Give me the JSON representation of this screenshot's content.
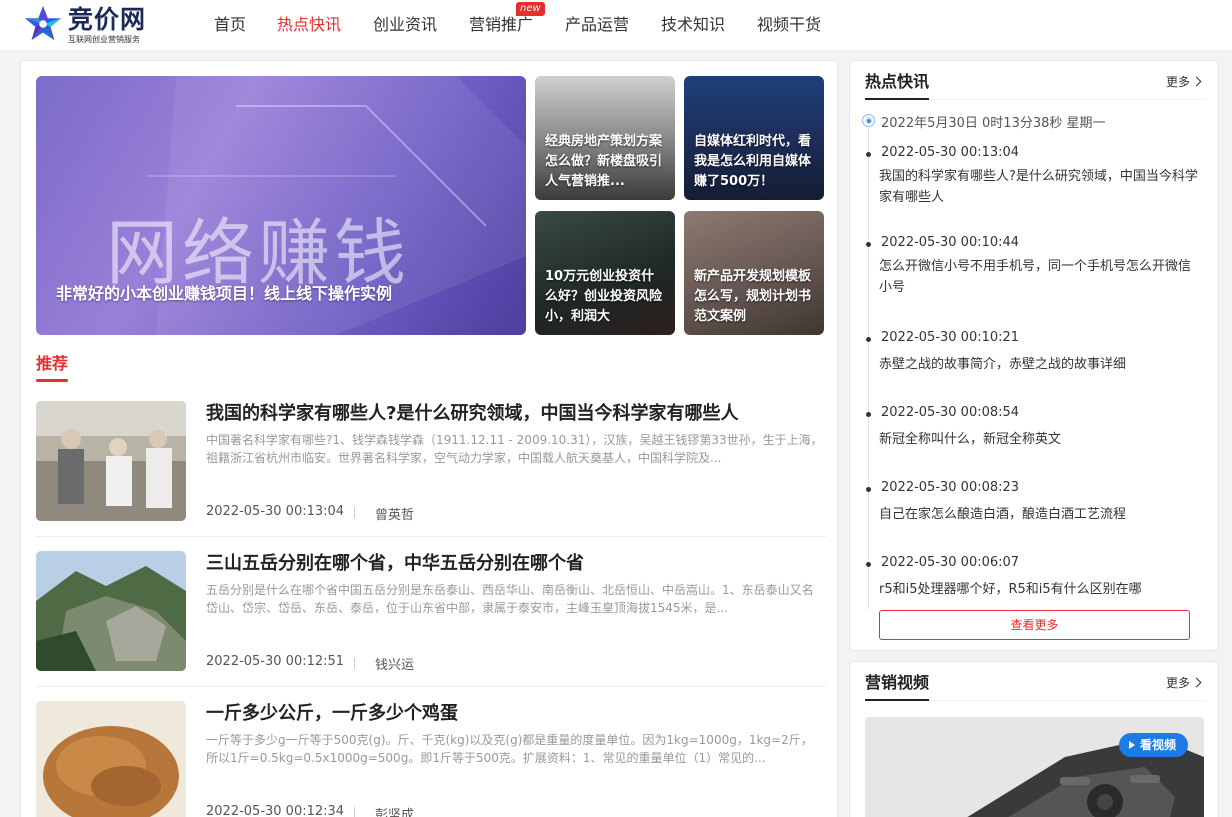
{
  "brand": {
    "name": "竞价网",
    "tagline": "互联网创业营销服务"
  },
  "nav": {
    "items": [
      {
        "label": "首页"
      },
      {
        "label": "热点快讯"
      },
      {
        "label": "创业资讯"
      },
      {
        "label": "营销推广"
      },
      {
        "label": "产品运营"
      },
      {
        "label": "技术知识"
      },
      {
        "label": "视频干货"
      }
    ],
    "active_index": 1,
    "new_badge": "new"
  },
  "hero": {
    "main": {
      "image_text": "网络赚钱",
      "caption": "非常好的小本创业赚钱项目！线上线下操作实例"
    },
    "thumbs": [
      {
        "caption": "经典房地产策划方案怎么做？新楼盘吸引人气营销推..."
      },
      {
        "caption": "自媒体红利时代，看我是怎么利用自媒体赚了500万！"
      },
      {
        "caption": "10万元创业投资什么好？创业投资风险小，利润大"
      },
      {
        "caption": "新产品开发规划模板怎么写，规划计划书范文案例"
      }
    ]
  },
  "recommend": {
    "title": "推荐",
    "articles": [
      {
        "title": "我国的科学家有哪些人?是什么研究领域，中国当今科学家有哪些人",
        "desc": "中国著名科学家有哪些?1、钱学森钱学森（1911.12.11 - 2009.10.31），汉族，吴越王钱镠第33世孙，生于上海，祖籍浙江省杭州市临安。世界著名科学家，空气动力学家，中国载人航天奠基人，中国科学院及...",
        "date": "2022-05-30 00:13:04",
        "author": "曾英哲"
      },
      {
        "title": "三山五岳分别在哪个省，中华五岳分别在哪个省",
        "desc": "五岳分别是什么在哪个省中国五岳分别是东岳泰山、西岳华山、南岳衡山、北岳恒山、中岳嵩山。1、东岳泰山又名岱山、岱宗、岱岳、东岳、泰岳，位于山东省中部，隶属于泰安市，主峰玉皇顶海拔1545米，是...",
        "date": "2022-05-30 00:12:51",
        "author": "钱兴运"
      },
      {
        "title": "一斤多少公斤，一斤多少个鸡蛋",
        "desc": "一斤等于多少g一斤等于500克(g)。斤、千克(kg)以及克(g)都是重量的度量单位。因为1kg=1000g，1kg=2斤，所以1斤=0.5kg=0.5x1000g=500g。即1斤等于500克。扩展资料：1、常见的重量单位（1）常见的...",
        "date": "2022-05-30 00:12:34",
        "author": "彭坚成"
      }
    ]
  },
  "hot_news": {
    "title": "热点快讯",
    "more_label": "更多",
    "now": "2022年5月30日 0时13分38秒 星期一",
    "items": [
      {
        "time": "2022-05-30 00:13:04",
        "text": "我国的科学家有哪些人?是什么研究领域，中国当今科学家有哪些人"
      },
      {
        "time": "2022-05-30 00:10:44",
        "text": "怎么开微信小号不用手机号，同一个手机号怎么开微信小号"
      },
      {
        "time": "2022-05-30 00:10:21",
        "text": "赤壁之战的故事简介，赤壁之战的故事详细"
      },
      {
        "time": "2022-05-30 00:08:54",
        "text": "新冠全称叫什么，新冠全称英文"
      },
      {
        "time": "2022-05-30 00:08:23",
        "text": "自己在家怎么酿造白酒，酿造白酒工艺流程"
      },
      {
        "time": "2022-05-30 00:06:07",
        "text": "r5和i5处理器哪个好，R5和i5有什么区别在哪"
      }
    ],
    "see_more_label": "查看更多"
  },
  "marketing_video": {
    "title": "营销视频",
    "more_label": "更多",
    "watch_label": "看视频"
  },
  "colors": {
    "accent": "#e62e2e",
    "video_button": "#1e7be6"
  }
}
